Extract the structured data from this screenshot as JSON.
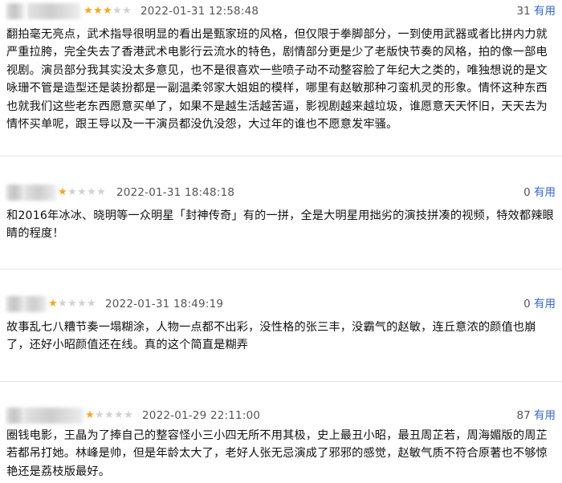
{
  "reviews": [
    {
      "time": "2022-01-31 12:58:48",
      "stars": 3,
      "useful_count": "31",
      "useful_label": "有用",
      "text": "翻拍毫无亮点，武术指导很明显的看出是甄家班的风格，但仅限于拳脚部分，一到使用武器或者比拼内力就严重拉胯，完全失去了香港武术电影行云流水的特色，剧情部分更是少了老版快节奏的风格，拍的像一部电视剧。演员部分我其实没太多意见，也不是很喜欢一些喷子动不动整容脸了年纪大之类的，唯独想说的是文咏珊不管是造型还是装扮都是一副温柔邻家大姐姐的模样，哪里有赵敏那种刁蛮机灵的形象。情怀这种东西也就我们这些老东西愿意买单了，如果不是越生活越苦逼，影视剧越来越垃圾，谁愿意天天怀旧，天天去为情怀买单呢，跟王导以及一干演员都没仇没怨，大过年的谁也不愿意发牢骚。"
    },
    {
      "time": "2022-01-31 18:48:18",
      "stars": 1,
      "useful_count": "0",
      "useful_label": "有用",
      "text": "和2016年冰冰、晓明等一众明星「封神传奇」有的一拼，全是大明星用拙劣的演技拼凑的视频，特效都辣眼睛的程度！"
    },
    {
      "time": "2022-01-31 18:49:19",
      "stars": 1,
      "useful_count": "0",
      "useful_label": "有用",
      "text": "故事乱七八糟节奏一塌糊涂，人物一点都不出彩，没性格的张三丰，没霸气的赵敏，连丘意浓的颜值也崩了，还好小昭颜值还在线。真的这个简直是糊弄"
    },
    {
      "time": "2022-01-29 22:11:00",
      "stars": 1,
      "useful_count": "87",
      "useful_label": "有用",
      "text": "圈钱电影，王晶为了捧自己的整容怪小三小四无所不用其极，史上最丑小昭，最丑周芷若，周海媚版的周芷若都吊打她。林峰是帅，但是年龄太大了，老好人张无忌演成了邪邪的感觉，赵敏气质不符合原著也不够惊艳还是荔枝版最好。"
    }
  ],
  "colors": {
    "star_on": "#f5a623",
    "star_off": "#d2d2d2",
    "useful_label": "#3366cc",
    "meta_text": "#555555"
  }
}
